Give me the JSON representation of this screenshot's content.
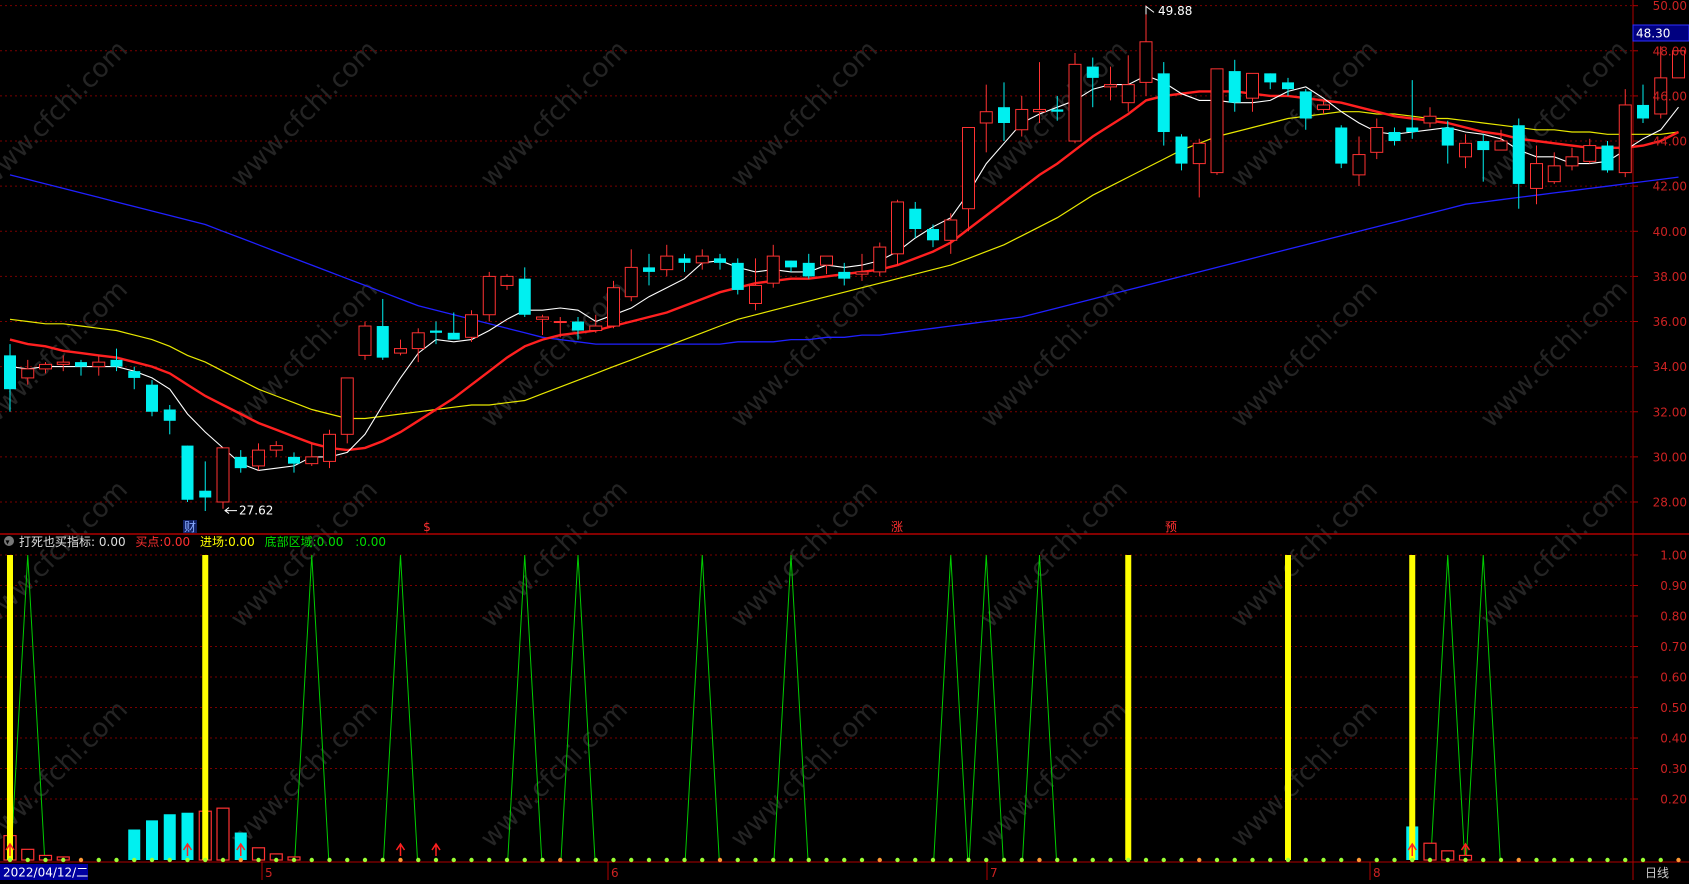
{
  "app": {
    "date_label": "2022/04/12/二",
    "period_label": "日线",
    "watermark": "www.cfchi.com",
    "month_labels": [
      "5",
      "6",
      "7",
      "8"
    ],
    "event_markers": [
      "财",
      "$",
      "涨",
      "预"
    ],
    "price_tag": "48.30",
    "high_annotation": "49.88",
    "low_annotation": "27.62"
  },
  "indicator": {
    "name": "打死也买指标",
    "name_value": ": 0.00",
    "fields": [
      {
        "label": "买点:",
        "value": "0.00",
        "color": "#ff3030"
      },
      {
        "label": "进场:",
        "value": "0.00",
        "color": "#ffff00"
      },
      {
        "label": "底部区域:",
        "value": "0.00",
        "color": "#00dd00"
      },
      {
        "label": ":",
        "value": "0.00",
        "color": "#00dd00"
      }
    ]
  },
  "colors": {
    "up": "#ff3232",
    "down": "#00f0f0",
    "ma5": "#ffffff",
    "ma10": "#ff2020",
    "ma20": "#e8e800",
    "ma60": "#2020ff",
    "green": "#00cc00",
    "yellow": "#ffff00",
    "axis": "#b00000"
  },
  "chart_data": [
    {
      "type": "candlestick",
      "ylim": [
        27,
        50
      ],
      "y_ticks": [
        "28.00",
        "30.00",
        "32.00",
        "34.00",
        "36.00",
        "38.00",
        "40.00",
        "42.00",
        "44.00",
        "46.00",
        "48.00",
        "50.00"
      ],
      "bars": [
        [
          34.5,
          33.0,
          35.0,
          32.0
        ],
        [
          33.5,
          33.9,
          34.3,
          33.2
        ],
        [
          33.9,
          34.1,
          34.2,
          33.7
        ],
        [
          34.1,
          34.2,
          34.5,
          33.8
        ],
        [
          34.2,
          34.0,
          34.3,
          33.6
        ],
        [
          34.0,
          34.2,
          34.5,
          33.6
        ],
        [
          34.3,
          34.0,
          34.8,
          33.8
        ],
        [
          33.8,
          33.5,
          34.0,
          33.0
        ],
        [
          33.2,
          32.0,
          33.4,
          31.8
        ],
        [
          32.1,
          31.6,
          32.3,
          31.0
        ],
        [
          30.5,
          28.1,
          30.5,
          28.0
        ],
        [
          28.5,
          28.2,
          29.8,
          27.6
        ],
        [
          28.0,
          30.4,
          30.4,
          27.7
        ],
        [
          30.0,
          29.5,
          30.3,
          29.3
        ],
        [
          29.6,
          30.3,
          30.6,
          29.4
        ],
        [
          30.3,
          30.5,
          30.7,
          30.0
        ],
        [
          30.0,
          29.7,
          30.2,
          29.3
        ],
        [
          29.7,
          30.0,
          30.6,
          29.6
        ],
        [
          29.8,
          31.0,
          31.2,
          29.5
        ],
        [
          31.0,
          33.5,
          33.5,
          30.6
        ],
        [
          34.5,
          35.8,
          36.0,
          34.3
        ],
        [
          35.8,
          34.4,
          37.0,
          34.3
        ],
        [
          34.6,
          34.8,
          35.2,
          34.5
        ],
        [
          34.8,
          35.5,
          35.7,
          34.2
        ],
        [
          35.6,
          35.5,
          36.0,
          35.0
        ],
        [
          35.5,
          35.2,
          36.4,
          35.3
        ],
        [
          35.3,
          36.3,
          36.5,
          35.1
        ],
        [
          36.3,
          38.0,
          38.2,
          36.0
        ],
        [
          37.6,
          38.0,
          38.1,
          37.4
        ],
        [
          37.9,
          36.3,
          38.4,
          36.2
        ],
        [
          36.1,
          36.2,
          36.3,
          35.4
        ],
        [
          36.0,
          36.0,
          36.2,
          35.3
        ],
        [
          36.0,
          35.6,
          36.2,
          35.2
        ],
        [
          35.6,
          35.8,
          36.3,
          35.5
        ],
        [
          35.8,
          37.5,
          37.8,
          35.7
        ],
        [
          37.1,
          38.4,
          39.2,
          36.9
        ],
        [
          38.4,
          38.2,
          39.0,
          37.6
        ],
        [
          38.3,
          38.9,
          39.4,
          38.0
        ],
        [
          38.8,
          38.6,
          39.0,
          38.2
        ],
        [
          38.6,
          38.9,
          39.2,
          38.3
        ],
        [
          38.8,
          38.6,
          39.0,
          38.3
        ],
        [
          38.6,
          37.4,
          38.8,
          37.2
        ],
        [
          36.8,
          37.6,
          38.8,
          36.5
        ],
        [
          37.7,
          38.9,
          39.4,
          37.5
        ],
        [
          38.7,
          38.4,
          38.7,
          38.2
        ],
        [
          38.6,
          38.0,
          39.0,
          37.9
        ],
        [
          38.5,
          38.9,
          38.9,
          38.1
        ],
        [
          38.2,
          37.9,
          38.6,
          37.6
        ],
        [
          38.1,
          38.2,
          39.0,
          37.8
        ],
        [
          38.2,
          39.3,
          39.5,
          38.0
        ],
        [
          39.0,
          41.3,
          41.4,
          38.5
        ],
        [
          41.0,
          40.1,
          41.3,
          39.7
        ],
        [
          40.1,
          39.6,
          40.3,
          39.3
        ],
        [
          39.6,
          40.5,
          40.8,
          39.0
        ],
        [
          41.0,
          44.6,
          44.6,
          40.0
        ],
        [
          44.8,
          45.3,
          46.5,
          43.5
        ],
        [
          45.5,
          44.8,
          46.6,
          44.0
        ],
        [
          44.5,
          45.4,
          46.0,
          44.2
        ],
        [
          45.3,
          45.4,
          47.5,
          44.8
        ],
        [
          45.4,
          45.3,
          46.0,
          44.9
        ],
        [
          44.0,
          47.4,
          47.9,
          43.9
        ],
        [
          47.3,
          46.8,
          47.7,
          45.5
        ],
        [
          46.4,
          46.5,
          47.3,
          45.8
        ],
        [
          45.7,
          46.5,
          47.8,
          45.3
        ],
        [
          46.6,
          48.4,
          49.88,
          46.0
        ],
        [
          47.0,
          44.4,
          47.5,
          43.8
        ],
        [
          44.2,
          43.0,
          44.3,
          42.7
        ],
        [
          43.0,
          43.9,
          44.1,
          41.5
        ],
        [
          42.6,
          47.2,
          47.2,
          42.5
        ],
        [
          47.1,
          45.7,
          47.6,
          45.3
        ],
        [
          45.9,
          47.0,
          47.0,
          45.3
        ],
        [
          47.0,
          46.6,
          47.0,
          46.3
        ],
        [
          46.6,
          46.3,
          46.8,
          46.0
        ],
        [
          46.2,
          45.0,
          46.3,
          44.5
        ],
        [
          45.4,
          45.6,
          45.8,
          45.2
        ],
        [
          44.6,
          43.0,
          44.7,
          42.8
        ],
        [
          42.5,
          43.4,
          44.2,
          42.0
        ],
        [
          43.5,
          44.6,
          45.0,
          43.2
        ],
        [
          44.4,
          44.0,
          44.6,
          43.8
        ],
        [
          44.6,
          44.4,
          46.7,
          44.1
        ],
        [
          44.8,
          45.1,
          45.5,
          44.6
        ],
        [
          44.6,
          43.8,
          44.9,
          43.0
        ],
        [
          43.3,
          43.9,
          44.3,
          42.8
        ],
        [
          44.0,
          43.6,
          44.3,
          42.2
        ],
        [
          43.6,
          44.0,
          44.5,
          43.7
        ],
        [
          44.7,
          42.1,
          45.0,
          41.0
        ],
        [
          41.9,
          43.0,
          43.8,
          41.2
        ],
        [
          42.2,
          42.9,
          43.5,
          42.1
        ],
        [
          42.9,
          43.3,
          43.7,
          42.7
        ],
        [
          43.1,
          43.8,
          44.1,
          43.0
        ],
        [
          43.8,
          42.7,
          44.0,
          42.6
        ],
        [
          42.6,
          45.6,
          46.3,
          42.4
        ],
        [
          45.6,
          45.0,
          46.5,
          44.8
        ],
        [
          45.2,
          46.8,
          48.2,
          45.0
        ],
        [
          46.8,
          48.0,
          48.0,
          47.2
        ]
      ],
      "ma5": [
        34.0,
        33.9,
        34.0,
        34.0,
        34.0,
        34.0,
        34.0,
        33.8,
        33.5,
        33.0,
        31.9,
        31.1,
        30.4,
        29.7,
        29.4,
        29.5,
        29.6,
        30.0,
        30.0,
        30.2,
        31.0,
        32.3,
        33.5,
        34.6,
        35.2,
        35.1,
        35.2,
        35.6,
        36.1,
        36.5,
        36.5,
        36.6,
        36.5,
        36.0,
        36.3,
        36.6,
        37.1,
        37.5,
        37.9,
        38.6,
        38.7,
        38.4,
        38.2,
        38.3,
        38.2,
        38.2,
        38.5,
        38.4,
        38.5,
        38.7,
        39.1,
        39.7,
        40.2,
        40.6,
        41.7,
        43.0,
        43.9,
        44.8,
        45.2,
        45.5,
        45.8,
        46.3,
        46.5,
        46.5,
        46.9,
        46.6,
        46.1,
        45.8,
        45.8,
        45.7,
        45.7,
        45.8,
        46.2,
        46.4,
        45.9,
        45.3,
        44.8,
        44.4,
        44.3,
        44.4,
        44.5,
        44.6,
        44.4,
        44.3,
        44.1,
        43.6,
        43.3,
        43.3,
        43.0,
        43.0,
        43.1,
        43.6,
        44.1,
        44.5,
        45.5
      ],
      "ma10": [
        35.2,
        35.0,
        34.9,
        34.7,
        34.6,
        34.5,
        34.4,
        34.2,
        34.0,
        33.7,
        33.2,
        32.7,
        32.3,
        31.9,
        31.5,
        31.2,
        30.9,
        30.6,
        30.4,
        30.3,
        30.4,
        30.7,
        31.1,
        31.6,
        32.1,
        32.6,
        33.2,
        33.8,
        34.4,
        34.9,
        35.2,
        35.4,
        35.5,
        35.6,
        35.8,
        36.0,
        36.2,
        36.4,
        36.7,
        37.0,
        37.3,
        37.5,
        37.7,
        37.8,
        37.9,
        37.9,
        38.0,
        38.1,
        38.2,
        38.3,
        38.5,
        38.8,
        39.1,
        39.5,
        40.1,
        40.7,
        41.3,
        41.9,
        42.5,
        43.0,
        43.6,
        44.2,
        44.7,
        45.2,
        45.8,
        46.0,
        46.1,
        46.2,
        46.2,
        46.2,
        46.1,
        46.0,
        46.0,
        45.9,
        45.8,
        45.7,
        45.5,
        45.3,
        45.1,
        45.0,
        44.9,
        44.8,
        44.6,
        44.4,
        44.3,
        44.1,
        44.0,
        43.9,
        43.8,
        43.7,
        43.7,
        43.7,
        43.8,
        44.0,
        44.4
      ],
      "ma20": [
        36.1,
        36.0,
        35.9,
        35.9,
        35.8,
        35.7,
        35.6,
        35.4,
        35.2,
        34.9,
        34.5,
        34.2,
        33.8,
        33.4,
        33.0,
        32.7,
        32.4,
        32.1,
        31.9,
        31.7,
        31.7,
        31.8,
        31.9,
        32.0,
        32.1,
        32.2,
        32.3,
        32.3,
        32.4,
        32.5,
        32.8,
        33.1,
        33.4,
        33.7,
        34.0,
        34.3,
        34.6,
        34.9,
        35.2,
        35.5,
        35.8,
        36.1,
        36.3,
        36.5,
        36.7,
        36.9,
        37.1,
        37.3,
        37.5,
        37.7,
        37.9,
        38.1,
        38.3,
        38.5,
        38.8,
        39.1,
        39.4,
        39.8,
        40.2,
        40.6,
        41.1,
        41.6,
        42.0,
        42.4,
        42.8,
        43.2,
        43.6,
        43.9,
        44.2,
        44.4,
        44.6,
        44.8,
        45.0,
        45.1,
        45.2,
        45.3,
        45.3,
        45.2,
        45.2,
        45.1,
        45.0,
        45.0,
        44.9,
        44.8,
        44.7,
        44.6,
        44.5,
        44.5,
        44.4,
        44.4,
        44.3,
        44.3,
        44.3,
        44.3,
        44.4
      ],
      "ma60": [
        42.5,
        42.3,
        42.1,
        41.9,
        41.7,
        41.5,
        41.3,
        41.1,
        40.9,
        40.7,
        40.5,
        40.3,
        40.0,
        39.7,
        39.4,
        39.1,
        38.8,
        38.5,
        38.2,
        37.9,
        37.6,
        37.3,
        37.0,
        36.7,
        36.5,
        36.3,
        36.1,
        35.9,
        35.7,
        35.5,
        35.3,
        35.2,
        35.1,
        35.0,
        35.0,
        35.0,
        35.0,
        35.0,
        35.0,
        35.0,
        35.0,
        35.1,
        35.1,
        35.1,
        35.2,
        35.2,
        35.3,
        35.3,
        35.4,
        35.4,
        35.5,
        35.6,
        35.7,
        35.8,
        35.9,
        36.0,
        36.1,
        36.2,
        36.4,
        36.6,
        36.8,
        37.0,
        37.2,
        37.4,
        37.6,
        37.8,
        38.0,
        38.2,
        38.4,
        38.6,
        38.8,
        39.0,
        39.2,
        39.4,
        39.6,
        39.8,
        40.0,
        40.2,
        40.4,
        40.6,
        40.8,
        41.0,
        41.2,
        41.3,
        41.4,
        41.5,
        41.6,
        41.7,
        41.8,
        41.9,
        42.0,
        42.1,
        42.2,
        42.3,
        42.4
      ]
    },
    {
      "type": "indicator",
      "ylim": [
        0,
        1.05
      ],
      "y_ticks": [
        "0.20",
        "0.30",
        "0.40",
        "0.50",
        "0.60",
        "0.70",
        "0.80",
        "0.90",
        "1.00"
      ],
      "bars": [
        {
          "i": 0,
          "h": 0.08,
          "c": "up"
        },
        {
          "i": 1,
          "h": 0.035,
          "c": "up"
        },
        {
          "i": 2,
          "h": 0.015,
          "c": "up"
        },
        {
          "i": 3,
          "h": 0.01,
          "c": "up"
        },
        {
          "i": 7,
          "h": 0.1,
          "c": "down"
        },
        {
          "i": 8,
          "h": 0.13,
          "c": "down"
        },
        {
          "i": 9,
          "h": 0.15,
          "c": "down"
        },
        {
          "i": 10,
          "h": 0.155,
          "c": "down"
        },
        {
          "i": 11,
          "h": 0.16,
          "c": "up"
        },
        {
          "i": 12,
          "h": 0.17,
          "c": "up"
        },
        {
          "i": 13,
          "h": 0.09,
          "c": "down"
        },
        {
          "i": 14,
          "h": 0.04,
          "c": "up"
        },
        {
          "i": 15,
          "h": 0.02,
          "c": "up"
        },
        {
          "i": 16,
          "h": 0.01,
          "c": "up"
        },
        {
          "i": 79,
          "h": 0.11,
          "c": "down"
        },
        {
          "i": 80,
          "h": 0.055,
          "c": "up"
        },
        {
          "i": 81,
          "h": 0.03,
          "c": "up"
        },
        {
          "i": 82,
          "h": 0.015,
          "c": "up"
        }
      ],
      "yellow_spikes": [
        0,
        11,
        63,
        72,
        79
      ],
      "green_spikes": [
        1,
        17,
        22,
        29,
        32,
        39,
        44,
        53,
        55,
        58,
        81,
        83
      ],
      "red_arrows": [
        0,
        10,
        13,
        22,
        24,
        79,
        82
      ]
    }
  ]
}
